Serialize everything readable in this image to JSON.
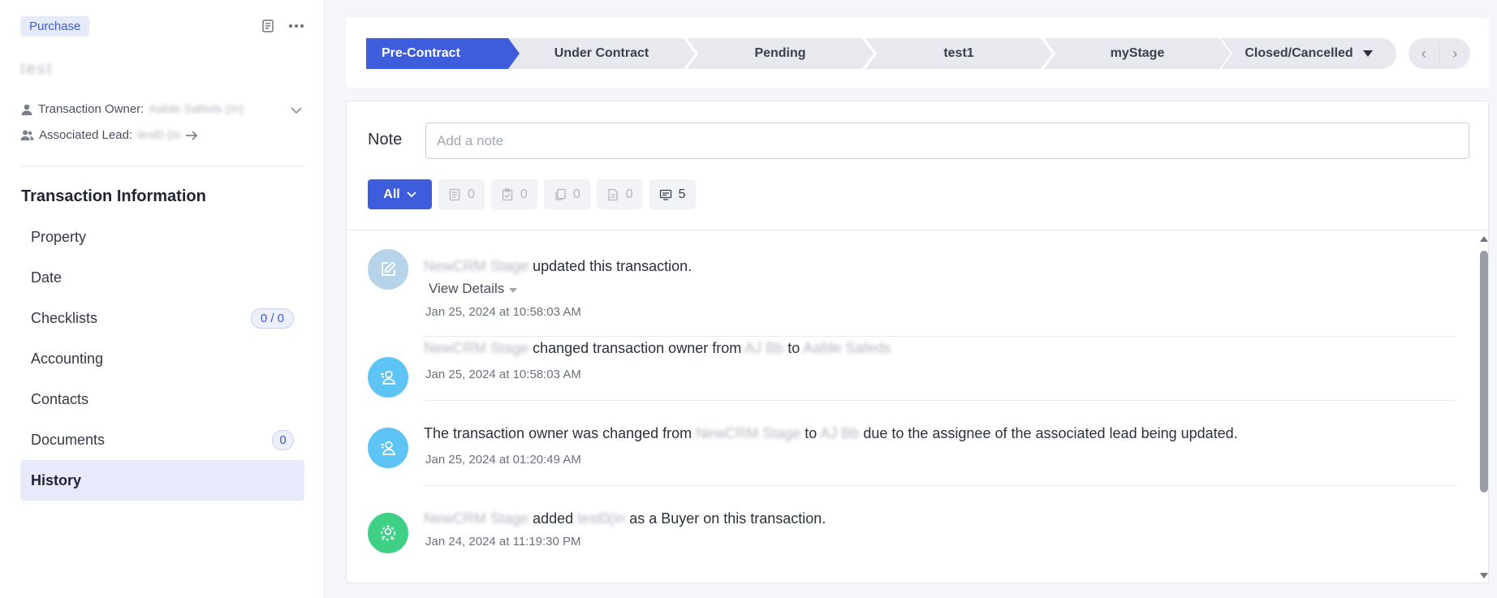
{
  "sidebar": {
    "type_badge": "Purchase",
    "title": "test",
    "owner_label": "Transaction Owner:",
    "owner_value": "Aafde Safeds (In)",
    "lead_label": "Associated Lead:",
    "lead_value": "test0 (in",
    "section_title": "Transaction Information",
    "items": [
      {
        "label": "Property"
      },
      {
        "label": "Date"
      },
      {
        "label": "Checklists",
        "count": "0 / 0"
      },
      {
        "label": "Accounting"
      },
      {
        "label": "Contacts"
      },
      {
        "label": "Documents",
        "count": "0"
      },
      {
        "label": "History"
      }
    ]
  },
  "stages": [
    "Pre-Contract",
    "Under Contract",
    "Pending",
    "test1",
    "myStage",
    "Closed/Cancelled"
  ],
  "note": {
    "label": "Note",
    "placeholder": "Add a note"
  },
  "filters": {
    "all_label": "All",
    "counts": [
      "0",
      "0",
      "0",
      "0",
      "5"
    ]
  },
  "history": [
    {
      "actor": "NewCRM Stage",
      "action": "updated this transaction.",
      "details_label": "View Details",
      "time": "Jan 25, 2024 at 10:58:03 AM"
    },
    {
      "actor": "NewCRM Stage",
      "action": "changed transaction owner from",
      "from": "AJ Bb",
      "to_word": "to",
      "to": "Aafde Safeds",
      "time": "Jan 25, 2024 at 10:58:03 AM"
    },
    {
      "prefix": "The transaction owner was changed from",
      "from": "NewCRM Stage",
      "to_word": "to",
      "to": "AJ Bb",
      "suffix": "due to the assignee of the associated lead being updated.",
      "time": "Jan 25, 2024 at 01:20:49 AM"
    },
    {
      "actor": "NewCRM Stage",
      "action": "added",
      "target": "test0(in",
      "suffix": "as a Buyer on this transaction.",
      "time": "Jan 24, 2024 at 11:19:30 PM"
    }
  ],
  "colors": {
    "accent": "#3d5ddc",
    "avatar_edit": "#b7d3ea",
    "avatar_user": "#5ec3f5",
    "avatar_buyer": "#3fd086"
  }
}
